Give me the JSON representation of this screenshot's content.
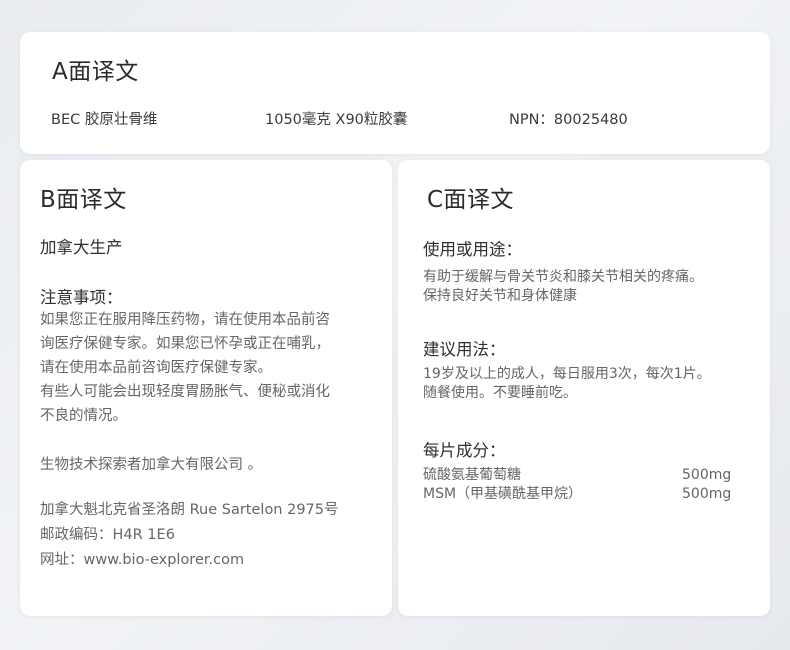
{
  "panel_a": {
    "title": "A面译文",
    "product_name": "BEC 胶原壮骨维",
    "spec": "1050毫克 X90粒胶囊",
    "npn": "NPN：80025480"
  },
  "panel_b": {
    "title": "B面译文",
    "made_in": "加拿大生产",
    "cautions_heading": "注意事项：",
    "cautions_lines": [
      "如果您正在服用降压药物，请在使用本品前咨",
      "询医疗保健专家。如果您已怀孕或正在哺乳，",
      "请在使用本品前咨询医疗保健专家。",
      "有些人可能会出现轻度胃肠胀气、便秘或消化",
      "不良的情况。"
    ],
    "company": "生物技术探索者加拿大有限公司 。",
    "address": "加拿大魁北克省圣洛朗 Rue Sartelon 2975号",
    "postal_code": "邮政编码：H4R 1E6",
    "website": "网址：www.bio-explorer.com"
  },
  "panel_c": {
    "title": "C面译文",
    "use_heading": "使用或用途：",
    "use_lines": [
      "有助于缓解与骨关节炎和膝关节相关的疼痛。",
      "保持良好关节和身体健康"
    ],
    "dosage_heading": "建议用法：",
    "dosage_lines": [
      "19岁及以上的成人，每日服用3次，每次1片。",
      "随餐使用。不要睡前吃。"
    ],
    "ingredients_heading": "每片成分：",
    "ingredients": [
      {
        "name": "硫酸氨基葡萄糖",
        "amount": "500mg"
      },
      {
        "name": "MSM（甲基磺酰基甲烷）",
        "amount": "500mg"
      }
    ]
  }
}
